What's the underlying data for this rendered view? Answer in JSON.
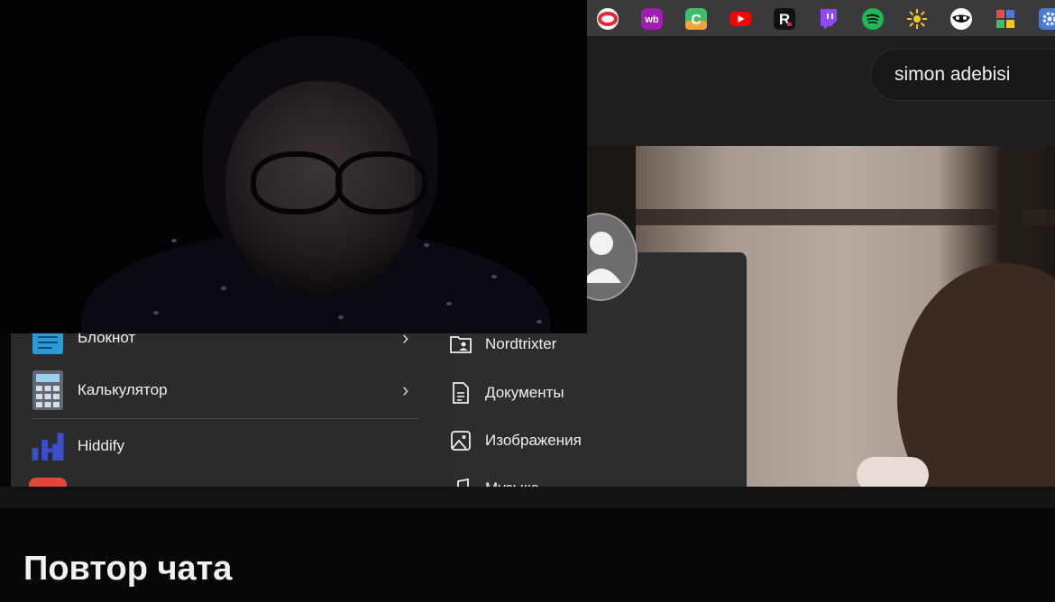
{
  "browser": {
    "extensions": [
      {
        "name": "opera-icon",
        "color": "#e8243b"
      },
      {
        "name": "wildberries-icon",
        "color": "#a31db5",
        "label": "wb"
      },
      {
        "name": "c-extension-icon",
        "color": "#3fbf6a",
        "label": "C"
      },
      {
        "name": "youtube-icon",
        "color": "#ff0000"
      },
      {
        "name": "r-extension-icon",
        "color": "#111111",
        "label": "R"
      },
      {
        "name": "twitch-icon",
        "color": "#9146ff"
      },
      {
        "name": "spotify-icon",
        "color": "#1db954"
      },
      {
        "name": "sun-extension-icon",
        "color": "#f3c623"
      },
      {
        "name": "mask-extension-icon",
        "color": "#ffffff"
      },
      {
        "name": "puzzle-extension-icon",
        "color": "#e94b4b"
      },
      {
        "name": "settings-extension-icon",
        "color": "#4a7bd1"
      }
    ]
  },
  "page": {
    "channel_name": "simon adebisi"
  },
  "start_menu": {
    "apps": [
      {
        "label": "Блокнот",
        "icon": "notepad-icon"
      },
      {
        "label": "Калькулятор",
        "icon": "calculator-icon"
      },
      {
        "label": "Hiddify",
        "icon": "hiddify-icon"
      }
    ],
    "links": [
      {
        "label": "Nordtrixter",
        "icon": "user-folder-icon"
      },
      {
        "label": "Документы",
        "icon": "document-icon"
      },
      {
        "label": "Изображения",
        "icon": "image-icon"
      },
      {
        "label": "Музыка",
        "icon": "music-icon"
      }
    ]
  },
  "chat": {
    "title": "Повтор чата"
  }
}
